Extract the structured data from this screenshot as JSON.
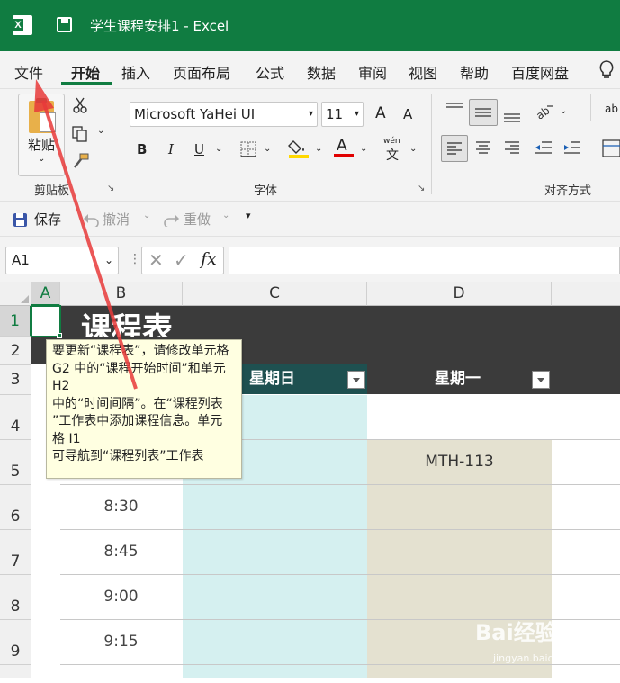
{
  "window": {
    "title": "学生课程安排1 - Excel"
  },
  "menu": {
    "tabs": [
      "文件",
      "开始",
      "插入",
      "页面布局",
      "公式",
      "数据",
      "审阅",
      "视图",
      "帮助",
      "百度网盘"
    ],
    "active": "开始"
  },
  "ribbon": {
    "paste_label": "粘贴",
    "clipboard_label": "剪贴板",
    "font_label": "字体",
    "alignment_label": "对齐方式",
    "font_name": "Microsoft YaHei UI",
    "font_size": "11",
    "bold": "B",
    "italic": "I",
    "underline": "U",
    "grow_font": "A",
    "shrink_font": "A",
    "font_color_letter": "A",
    "wen_label": "wén",
    "wen_char": "文",
    "abc_label": "ab c",
    "font_color": "#e00000",
    "fill_color": "#ffd800"
  },
  "quick_access": {
    "save": "保存",
    "undo": "撤消",
    "redo": "重做"
  },
  "formula_bar": {
    "name_box": "A1",
    "fx": "fx",
    "formula": ""
  },
  "grid": {
    "columns": [
      "A",
      "B",
      "C",
      "D"
    ],
    "rows": [
      "1",
      "2",
      "3",
      "4",
      "5",
      "6",
      "7",
      "8",
      "9"
    ],
    "title": "课程表",
    "day_headers": [
      "星期日",
      "星期一"
    ],
    "times": [
      "8:30",
      "8:45",
      "9:00",
      "9:15"
    ],
    "cells": {
      "d5": "MTH-113"
    },
    "colors": {
      "header_dark": "#3b3b3b",
      "title_band": "#3b3b3b",
      "sunday_col": "#d5f0f0",
      "monday_col": "#e4e1d0",
      "sunday_hdr": "#1e5050"
    }
  },
  "tooltip": {
    "lines": [
      "要更新“课程表”，请修改单元格",
      "G2 中的“课程开始时间”和单元",
      "H2",
      "中的“时间间隔”。在“课程列表",
      "”工作表中添加课程信息。单元",
      "格 I1",
      "可导航到“课程列表”工作表"
    ]
  },
  "watermark": {
    "text": "Bai经验",
    "sub": "jingyan.baidu.com"
  }
}
